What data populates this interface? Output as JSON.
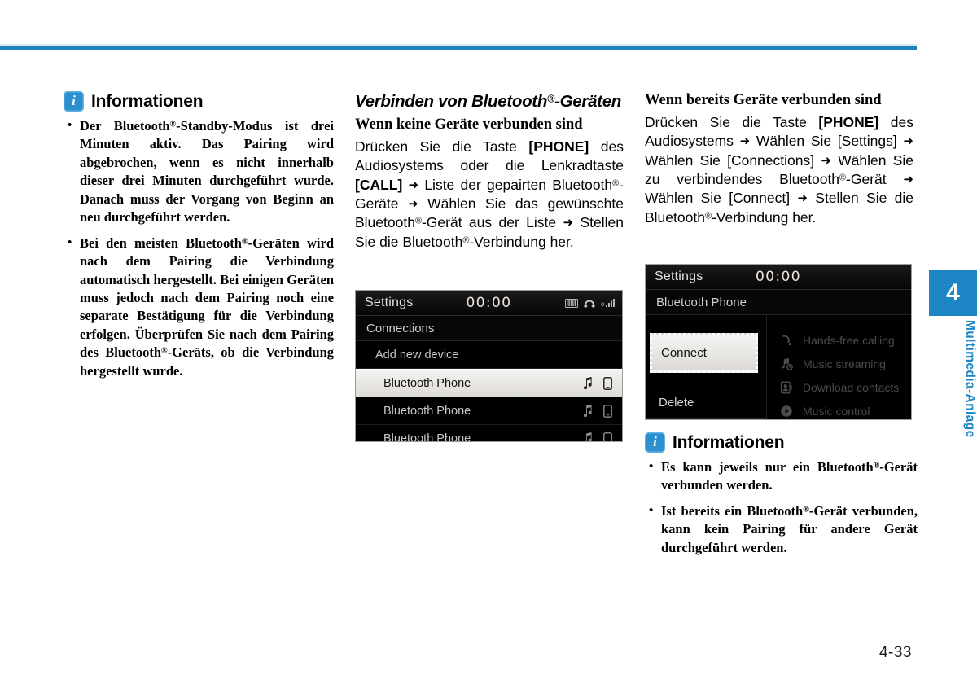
{
  "page": {
    "number": "4-33",
    "chapter_number": "4",
    "chapter_label": "Multimedia-Anlage",
    "accent_color": "#2080bd",
    "chapter_tab_color": "#1d86c4"
  },
  "column_left": {
    "info_box": {
      "icon": "info-icon",
      "title": "Informationen",
      "bullets": [
        "Der Bluetooth®-Standby-Modus ist drei Minuten aktiv. Das Pairing wird abgebrochen, wenn es nicht innerhalb dieser drei Minuten durchgeführt wurde. Danach muss der Vorgang von Beginn an neu durchgeführt werden.",
        "Bei den meisten Bluetooth®-Geräten wird nach dem Pairing die Verbindung automatisch hergestellt. Bei einigen Geräten muss jedoch nach dem Pairing noch eine separate Bestätigung für die Verbindung erfolgen. Überprüfen Sie nach dem Pairing des Bluetooth®-Geräts, ob die Verbindung hergestellt wurde."
      ]
    }
  },
  "column_middle": {
    "heading": "Verbinden von Bluetooth®-Geräten",
    "subheading": "Wenn keine Geräte verbunden sind",
    "body": "Drücken Sie die Taste [PHONE] des Audiosystems oder die Lenkradtaste [CALL] ➔ Liste der gepairten Bluetooth®-Geräte ➔ Wählen Sie das gewünschte Bluetooth®-Gerät aus der Liste ➔ Stellen Sie die Bluetooth®-Verbindung her.",
    "screenshot": {
      "title": "Settings",
      "clock": "00:00",
      "status_icons": [
        "sim-icon",
        "bluetooth-headset-icon",
        "signal-bars-icon"
      ],
      "subhead": "Connections",
      "rows": [
        {
          "label": "Add new device",
          "selected": false,
          "indent": false,
          "icons": []
        },
        {
          "label": "Bluetooth Phone",
          "selected": true,
          "indent": true,
          "icons": [
            "music-note-icon",
            "phone-icon"
          ]
        },
        {
          "label": "Bluetooth Phone",
          "selected": false,
          "indent": true,
          "icons": [
            "music-note-icon",
            "phone-icon"
          ]
        },
        {
          "label": "Bluetooth Phone",
          "selected": false,
          "indent": true,
          "icons": [
            "music-note-icon",
            "phone-icon"
          ]
        }
      ]
    }
  },
  "column_right": {
    "subheading": "Wenn bereits Geräte verbunden sind",
    "body": "Drücken Sie die Taste [PHONE] des Audiosystems ➔ Wählen Sie [Settings] ➔ Wählen Sie [Connections] ➔ Wählen Sie zu verbindendes Bluetooth®-Gerät ➔ Wählen Sie [Connect] ➔ Stellen Sie die Bluetooth®-Verbindung her.",
    "screenshot": {
      "title": "Settings",
      "clock": "00:00",
      "subhead": "Bluetooth Phone",
      "connect_label": "Connect",
      "delete_label": "Delete",
      "features": [
        {
          "label": "Hands-free calling",
          "icon": "handset-icon"
        },
        {
          "label": "Music streaming",
          "icon": "music-streaming-icon"
        },
        {
          "label": "Download contacts",
          "icon": "contact-card-icon"
        },
        {
          "label": "Music control",
          "icon": "play-icon"
        }
      ]
    },
    "info_box": {
      "icon": "info-icon",
      "title": "Informationen",
      "bullets": [
        "Es kann jeweils nur ein Bluetooth®-Gerät verbunden werden.",
        "Ist bereits ein Bluetooth®-Gerät verbunden, kann kein Pairing für andere Gerät durchgeführt werden."
      ]
    }
  }
}
